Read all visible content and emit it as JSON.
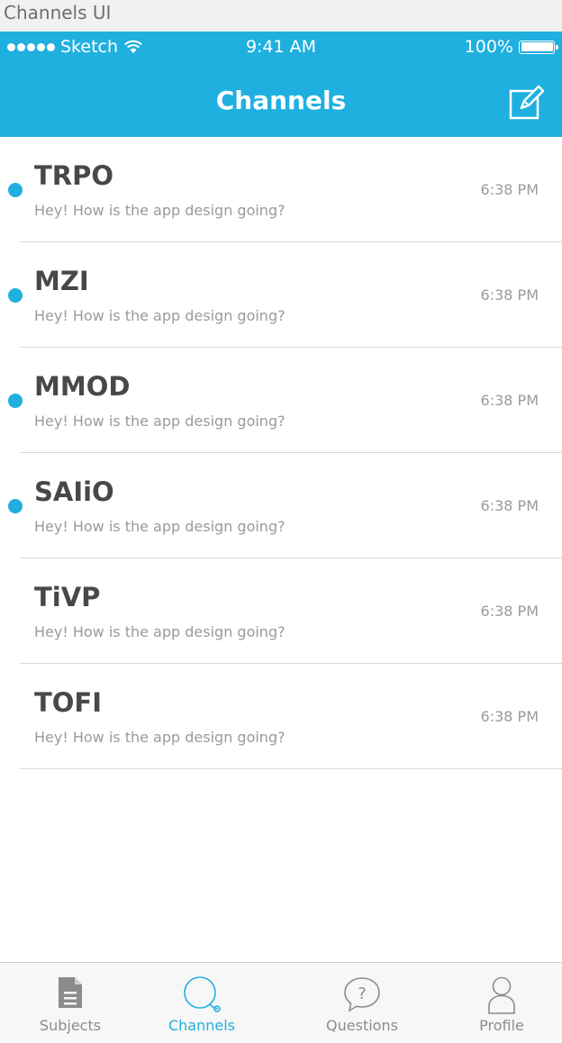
{
  "window": {
    "title": "Channels UI"
  },
  "status_bar": {
    "carrier": "Sketch",
    "time": "9:41 AM",
    "battery": "100%"
  },
  "header": {
    "title": "Channels",
    "compose_icon": "compose-icon"
  },
  "channels": [
    {
      "name": "TRPO",
      "preview": "Hey! How is the app design going?",
      "time": "6:38 PM",
      "unread": true
    },
    {
      "name": "MZI",
      "preview": "Hey! How is the app design going?",
      "time": "6:38 PM",
      "unread": true
    },
    {
      "name": "MMOD",
      "preview": "Hey! How is the app design going?",
      "time": "6:38 PM",
      "unread": true
    },
    {
      "name": "SAIiO",
      "preview": "Hey! How is the app design going?",
      "time": "6:38 PM",
      "unread": true
    },
    {
      "name": "TiVP",
      "preview": "Hey! How is the app design going?",
      "time": "6:38 PM",
      "unread": false
    },
    {
      "name": "TOFI",
      "preview": "Hey! How is the app design going?",
      "time": "6:38 PM",
      "unread": false
    }
  ],
  "tab_bar": {
    "tabs": [
      {
        "label": "Subjects",
        "icon": "document-icon",
        "active": false
      },
      {
        "label": "Channels",
        "icon": "chat-bubble-icon",
        "active": true
      },
      {
        "label": "Questions",
        "icon": "question-bubble-icon",
        "active": false
      },
      {
        "label": "Profile",
        "icon": "person-icon",
        "active": false
      }
    ]
  },
  "colors": {
    "accent": "#1fb0e0",
    "title_text": "#484848",
    "secondary_text": "#9a9a9a"
  }
}
